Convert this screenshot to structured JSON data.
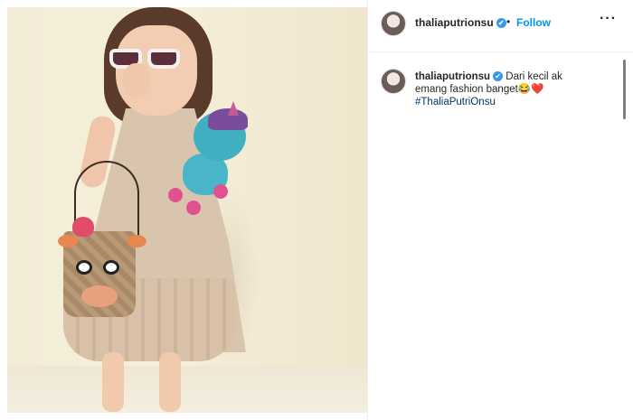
{
  "post": {
    "username": "thaliaputrionsu",
    "follow_label": "Follow",
    "separator": "•",
    "more_label": "···",
    "verified_icon": "✔",
    "caption_text": "Dari kecil ak emang fashion banget😂❤️",
    "hashtag": "#ThaliaPutriOnsu"
  },
  "colors": {
    "accent": "#0095f6",
    "verified": "#3897f0",
    "hashtag": "#00376b"
  },
  "icons": {
    "verified": "verified-badge-icon",
    "more": "more-options-icon"
  }
}
